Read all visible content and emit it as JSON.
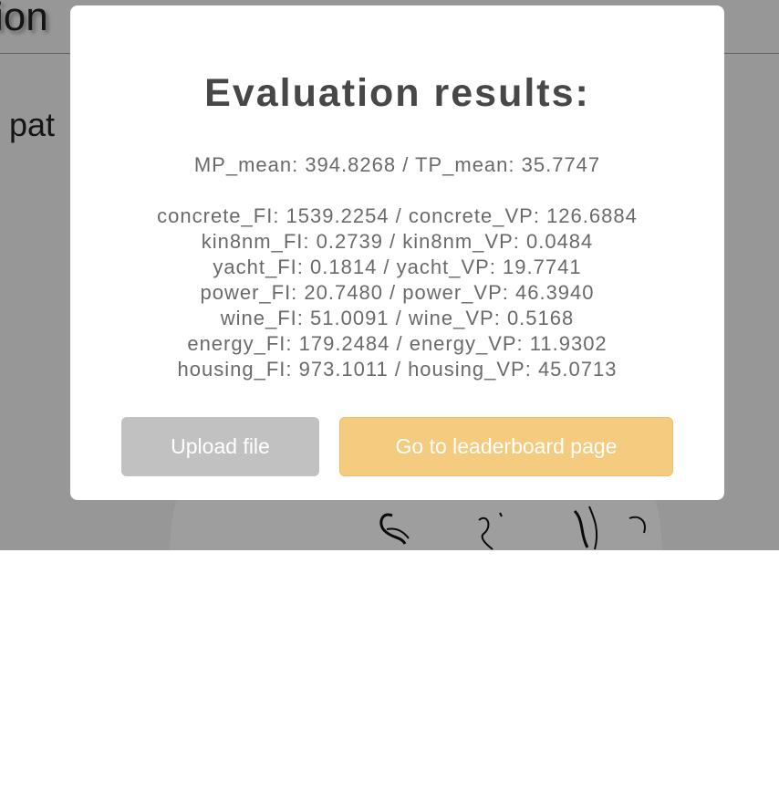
{
  "background": {
    "title_fragment": "ion",
    "text_fragment": "pat"
  },
  "modal": {
    "title": "Evaluation results:",
    "summary": "MP_mean: 394.8268 / TP_mean: 35.7747",
    "results": [
      "concrete_FI: 1539.2254 / concrete_VP: 126.6884",
      "kin8nm_FI: 0.2739 / kin8nm_VP: 0.0484",
      "yacht_FI: 0.1814 / yacht_VP: 19.7741",
      "power_FI: 20.7480 / power_VP: 46.3940",
      "wine_FI: 51.0091 / wine_VP: 0.5168",
      "energy_FI: 179.2484 / energy_VP: 11.9302",
      "housing_FI: 973.1011 / housing_VP: 45.0713"
    ],
    "buttons": {
      "upload": "Upload file",
      "leaderboard": "Go to leaderboard page"
    }
  },
  "colors": {
    "upload_button": "#c1c1c1",
    "leaderboard_button": "#f4cb7f",
    "title_text": "#474747",
    "body_text": "#6a6a6a"
  }
}
